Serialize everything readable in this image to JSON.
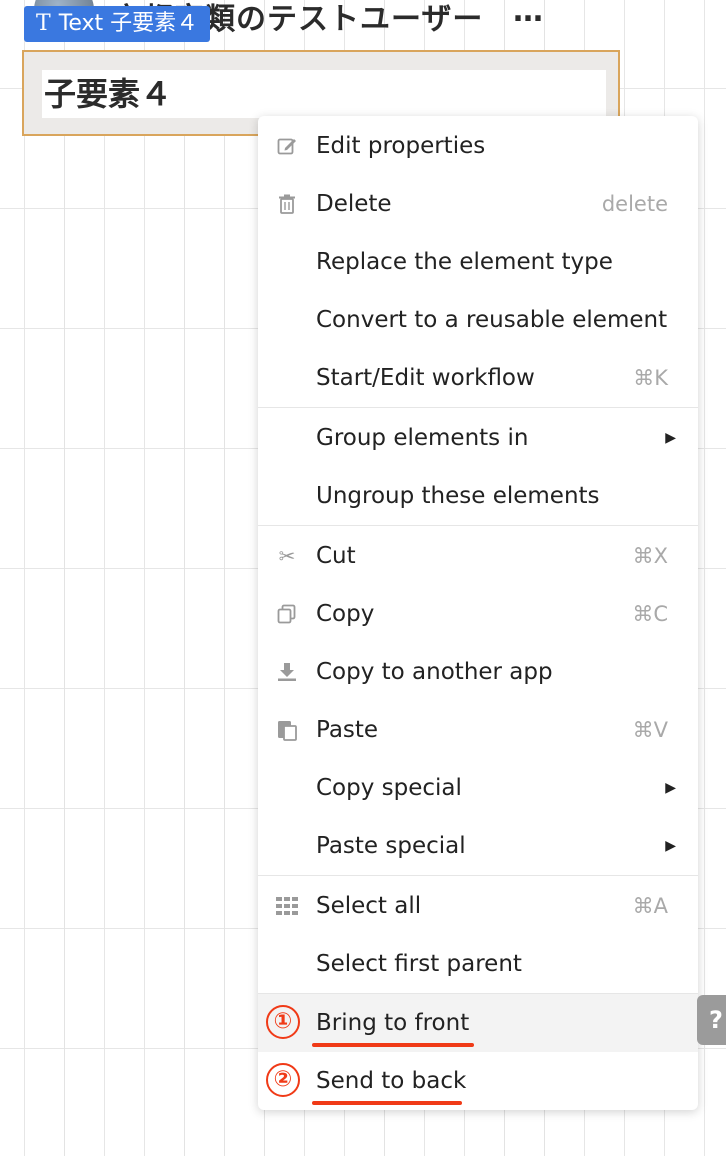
{
  "header": {
    "title": "宇都宮類のテストユーザー",
    "more_icon": "…"
  },
  "element_badge": {
    "type_icon": "T",
    "label": "Text 子要素４"
  },
  "selected_element": {
    "text": "子要素４"
  },
  "context_menu": {
    "items": [
      {
        "icon": "edit-icon",
        "label": "Edit properties",
        "shortcut": ""
      },
      {
        "icon": "trash-icon",
        "label": "Delete",
        "shortcut": "delete"
      },
      {
        "icon": "",
        "label": "Replace the element type",
        "shortcut": ""
      },
      {
        "icon": "",
        "label": "Convert to a reusable element",
        "shortcut": ""
      },
      {
        "icon": "",
        "label": "Start/Edit workflow",
        "shortcut": "⌘K"
      },
      {
        "icon": "",
        "label": "Group elements in",
        "shortcut": "",
        "submenu": true
      },
      {
        "icon": "",
        "label": "Ungroup these elements",
        "shortcut": ""
      },
      {
        "icon": "scissors-icon",
        "label": "Cut",
        "shortcut": "⌘X"
      },
      {
        "icon": "copy-icon",
        "label": "Copy",
        "shortcut": "⌘C"
      },
      {
        "icon": "download-icon",
        "label": "Copy to another app",
        "shortcut": ""
      },
      {
        "icon": "paste-icon",
        "label": "Paste",
        "shortcut": "⌘V"
      },
      {
        "icon": "",
        "label": "Copy special",
        "shortcut": "",
        "submenu": true
      },
      {
        "icon": "",
        "label": "Paste special",
        "shortcut": "",
        "submenu": true
      },
      {
        "icon": "grid-icon",
        "label": "Select all",
        "shortcut": "⌘A"
      },
      {
        "icon": "",
        "label": "Select first parent",
        "shortcut": ""
      },
      {
        "icon": "",
        "label": "Bring to front",
        "shortcut": "",
        "annotation": "①"
      },
      {
        "icon": "",
        "label": "Send to back",
        "shortcut": "",
        "annotation": "②"
      }
    ]
  },
  "help_tab": {
    "label": "?"
  },
  "colors": {
    "annotation_red": "#f03a17",
    "badge_blue": "#3a78e0",
    "selection_border": "#d9a55c"
  }
}
